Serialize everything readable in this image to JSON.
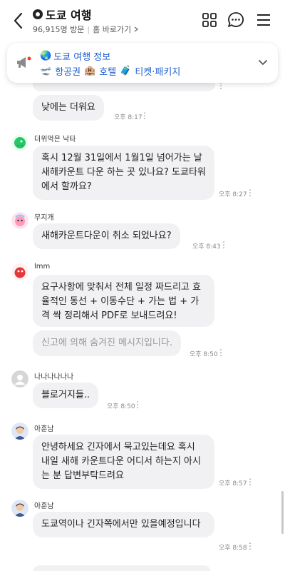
{
  "header": {
    "title": "도쿄 여행",
    "visits": "96,915명 방문",
    "separator": "|",
    "home_link": "홈 바로가기"
  },
  "notice": {
    "title": "도쿄 여행 정보",
    "links": [
      "항공권",
      "호텔",
      "티켓·패키지"
    ]
  },
  "messages": [
    {
      "text": "낮에는 더워요",
      "time": "오후 8:17"
    },
    {
      "sender": "더위먹은 낙타",
      "text": "혹시 12월 31일에서 1월1일 넘어가는 날 새해카운트 다운 하는 곳 있나요? 도쿄타워에서 할까요?",
      "time": "오후 8:27"
    },
    {
      "sender": "무지개",
      "text": "새해카운트다운이  취소 되었나요?",
      "time": "오후 8:43"
    },
    {
      "sender": "lmm",
      "text": "요구사항에 맞춰서 전체 일정 짜드리고 효율적인 동선 + 이동수단 + 가는 법 + 가격 싹 정리해서 PDF로 보내드려요!",
      "text2": "신고에 의해 숨겨진 메시지입니다.",
      "time": "오후 8:50"
    },
    {
      "sender": "나나나나나나",
      "text": "블로거지들..",
      "time": "오후 8:50"
    },
    {
      "sender": "아훈남",
      "text": "안녕하세요 긴자에서 묵고있는데요 혹시 내일 새해 카운트다운 어디서 하는지 아시는 분 답변부탁드려요",
      "time": "오후 8:57"
    },
    {
      "sender": "아훈남",
      "text": "도쿄역이나 긴자쪽에서만 있을예정입니다",
      "time": "오후 8:58"
    }
  ],
  "more_glyph": "⋮",
  "colors": {
    "accent": "#1f5fd1",
    "bubble": "#f1f1f3"
  }
}
